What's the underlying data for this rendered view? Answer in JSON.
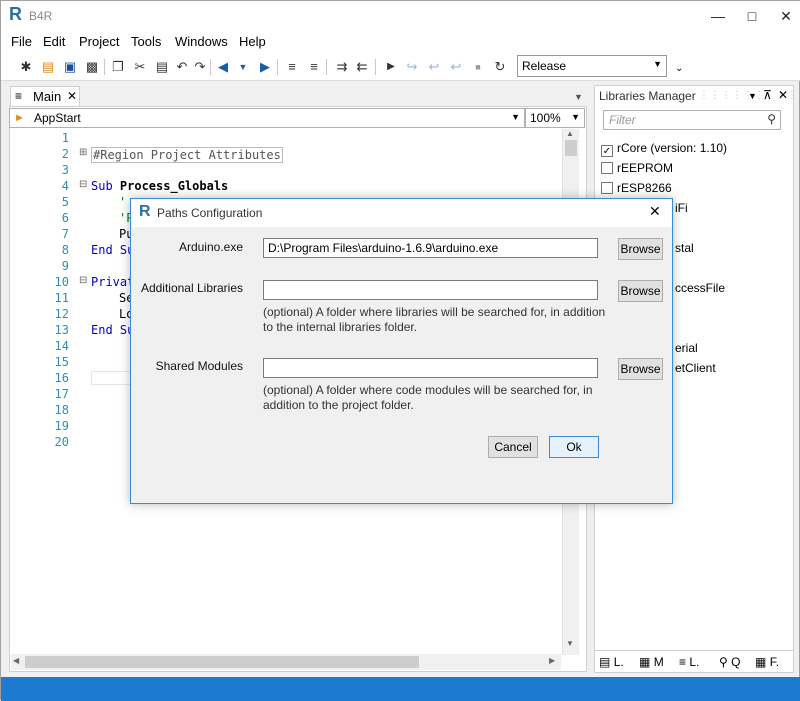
{
  "window": {
    "title": "B4R",
    "logo": "R"
  },
  "menu": [
    "File",
    "Edit",
    "Project",
    "Tools",
    "Windows",
    "Help"
  ],
  "toolbar": {
    "build_config": "Release"
  },
  "editor": {
    "tab_label": "Main",
    "sub_selector": "AppStart",
    "zoom": "100%",
    "line_numbers": [
      "1",
      "2",
      "3",
      "4",
      "5",
      "6",
      "7",
      "8",
      "9",
      "10",
      "11",
      "12",
      "13",
      "14",
      "15",
      "16",
      "17",
      "18",
      "19",
      "20"
    ],
    "lines": [
      {
        "n": 2,
        "text": "#Region Project Attributes"
      },
      {
        "n": 4,
        "kw": "Sub ",
        "text": "Process_Globals"
      },
      {
        "n": 5,
        "text": "'"
      },
      {
        "n": 6,
        "text": "'P"
      },
      {
        "n": 7,
        "text": "Pu"
      },
      {
        "n": 8,
        "kw": "End Su",
        "text": ""
      },
      {
        "n": 10,
        "kw": "Privat",
        "text": ""
      },
      {
        "n": 11,
        "text": "Se"
      },
      {
        "n": 12,
        "text": "Lo"
      },
      {
        "n": 13,
        "kw": "End Su",
        "text": ""
      }
    ]
  },
  "libraries": {
    "title": "Libraries Manager",
    "filter_placeholder": "Filter",
    "items": [
      {
        "label": "rCore (version: 1.10)",
        "checked": true
      },
      {
        "label": "rEEPROM",
        "checked": false
      },
      {
        "label": "rESP8266",
        "checked": false
      },
      {
        "label": "iFi",
        "checked": null
      },
      {
        "label": "stal",
        "checked": null
      },
      {
        "label": "ccessFile",
        "checked": null
      },
      {
        "label": "erial",
        "checked": null
      },
      {
        "label": "etClient",
        "checked": null
      }
    ],
    "tabs": [
      "L.",
      "M",
      "L.",
      "Q",
      "F."
    ]
  },
  "dialog": {
    "title": "Paths Configuration",
    "arduino_label": "Arduino.exe",
    "arduino_value": "D:\\Program Files\\arduino-1.6.9\\arduino.exe",
    "libraries_label": "Additional Libraries",
    "libraries_value": "",
    "libraries_hint": "(optional) A folder where libraries will be searched for, in addition to the internal libraries folder.",
    "modules_label": "Shared Modules",
    "modules_value": "",
    "modules_hint": "(optional) A folder where code modules will be searched for, in addition to the project folder.",
    "browse": "Browse",
    "cancel": "Cancel",
    "ok": "Ok"
  }
}
